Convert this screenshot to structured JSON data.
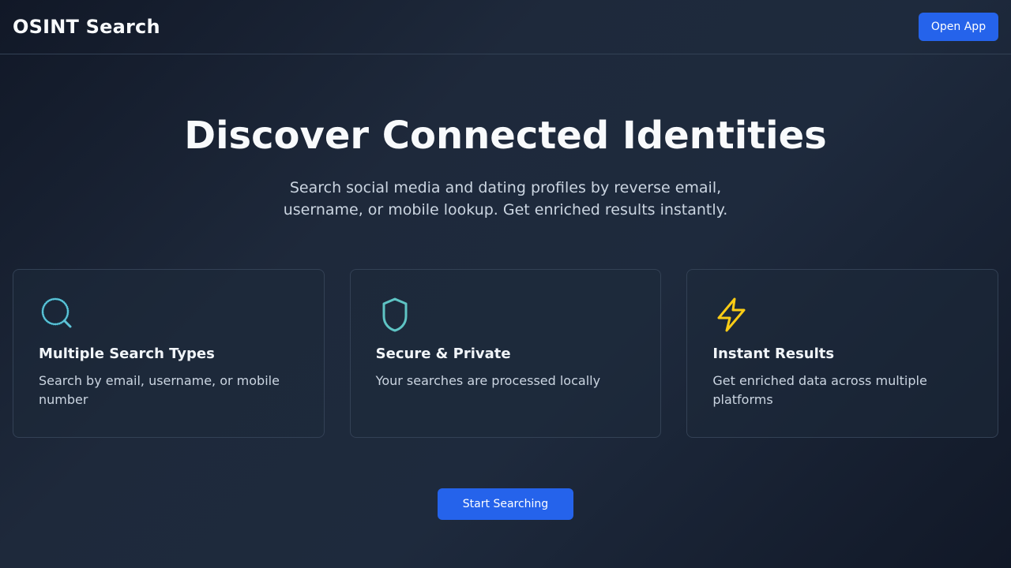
{
  "header": {
    "brand": "OSINT Search",
    "open_app_label": "Open App"
  },
  "hero": {
    "title": "Discover Connected Identities",
    "subtitle": "Search social media and dating profiles by reverse email, username, or mobile lookup. Get enriched results instantly."
  },
  "features": [
    {
      "icon": "search-icon",
      "icon_color": "#22b8cf",
      "title": "Multiple Search Types",
      "description": "Search by email, username, or mobile number"
    },
    {
      "icon": "shield-icon",
      "icon_color": "#5ec4c4",
      "title": "Secure & Private",
      "description": "Your searches are processed locally"
    },
    {
      "icon": "lightning-icon",
      "icon_color": "#facc15",
      "title": "Instant Results",
      "description": "Get enriched data across multiple platforms"
    }
  ],
  "cta": {
    "label": "Start Searching"
  },
  "colors": {
    "accent": "#2563eb",
    "background": "#111827",
    "card_border": "#334155"
  }
}
